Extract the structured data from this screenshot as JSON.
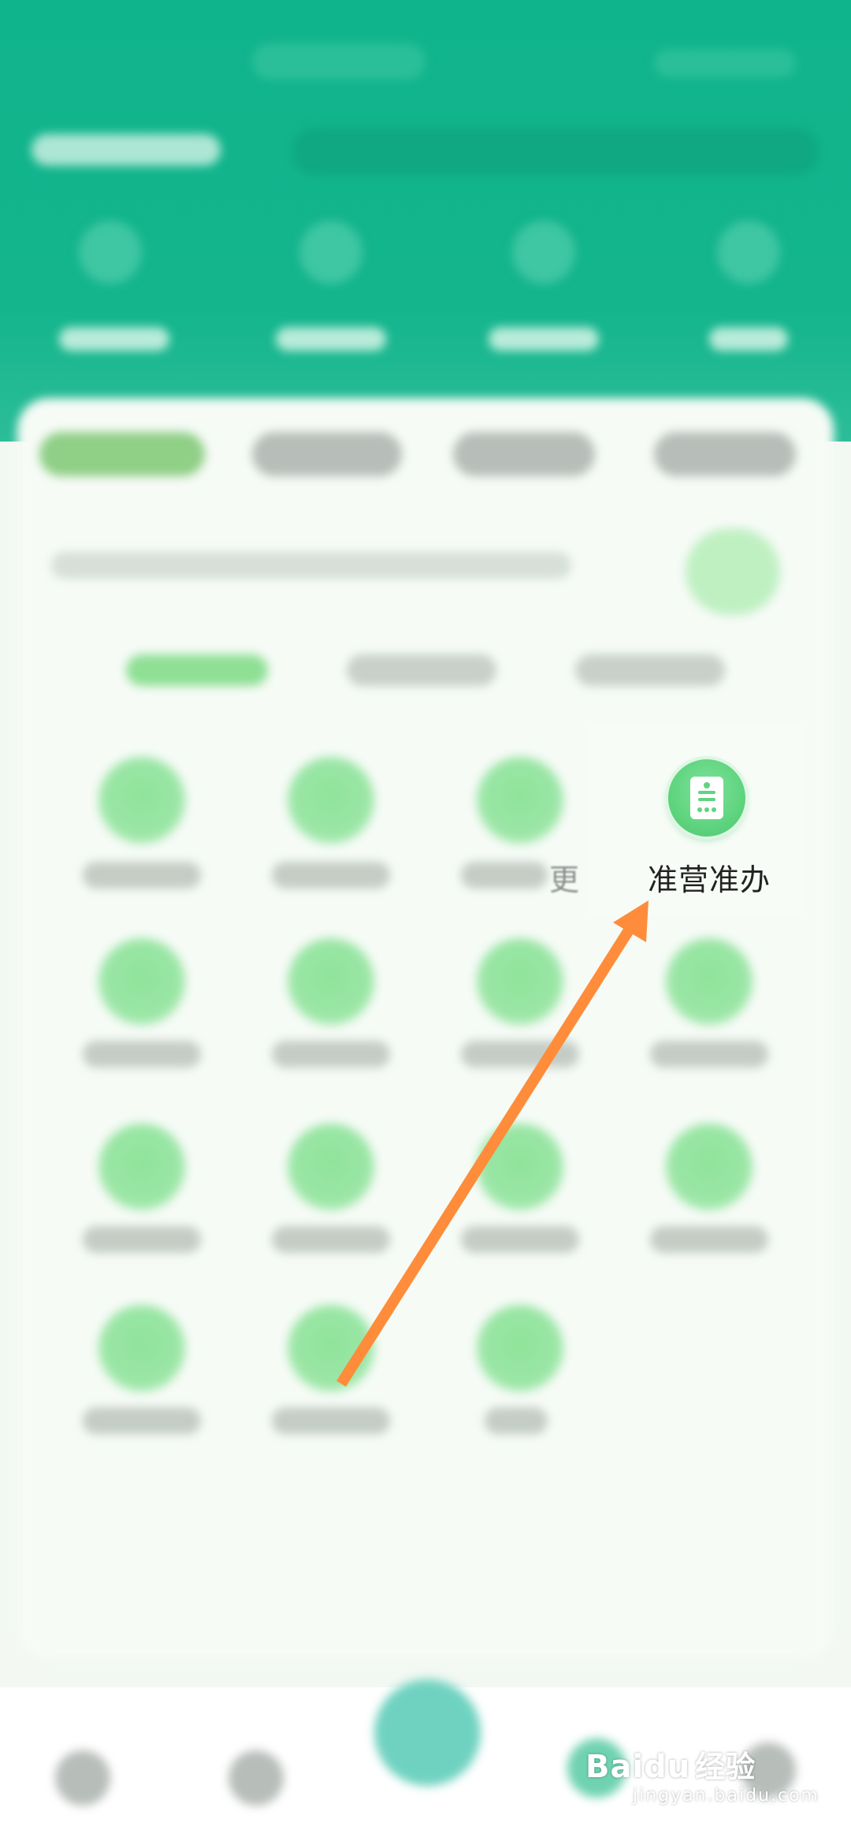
{
  "screen": {
    "highlighted_service": {
      "label": "准营准办",
      "icon": "document-icon"
    },
    "partial_neighbor_label": "更"
  },
  "watermark": {
    "brand": "Baidu",
    "brand_cn": "经验",
    "sub": "jingyan.baidu.com"
  },
  "annotation": {
    "arrow_color": "#ff8c3a"
  },
  "theme": {
    "primary": "#10b48c",
    "service_green": "#5fd47f"
  }
}
